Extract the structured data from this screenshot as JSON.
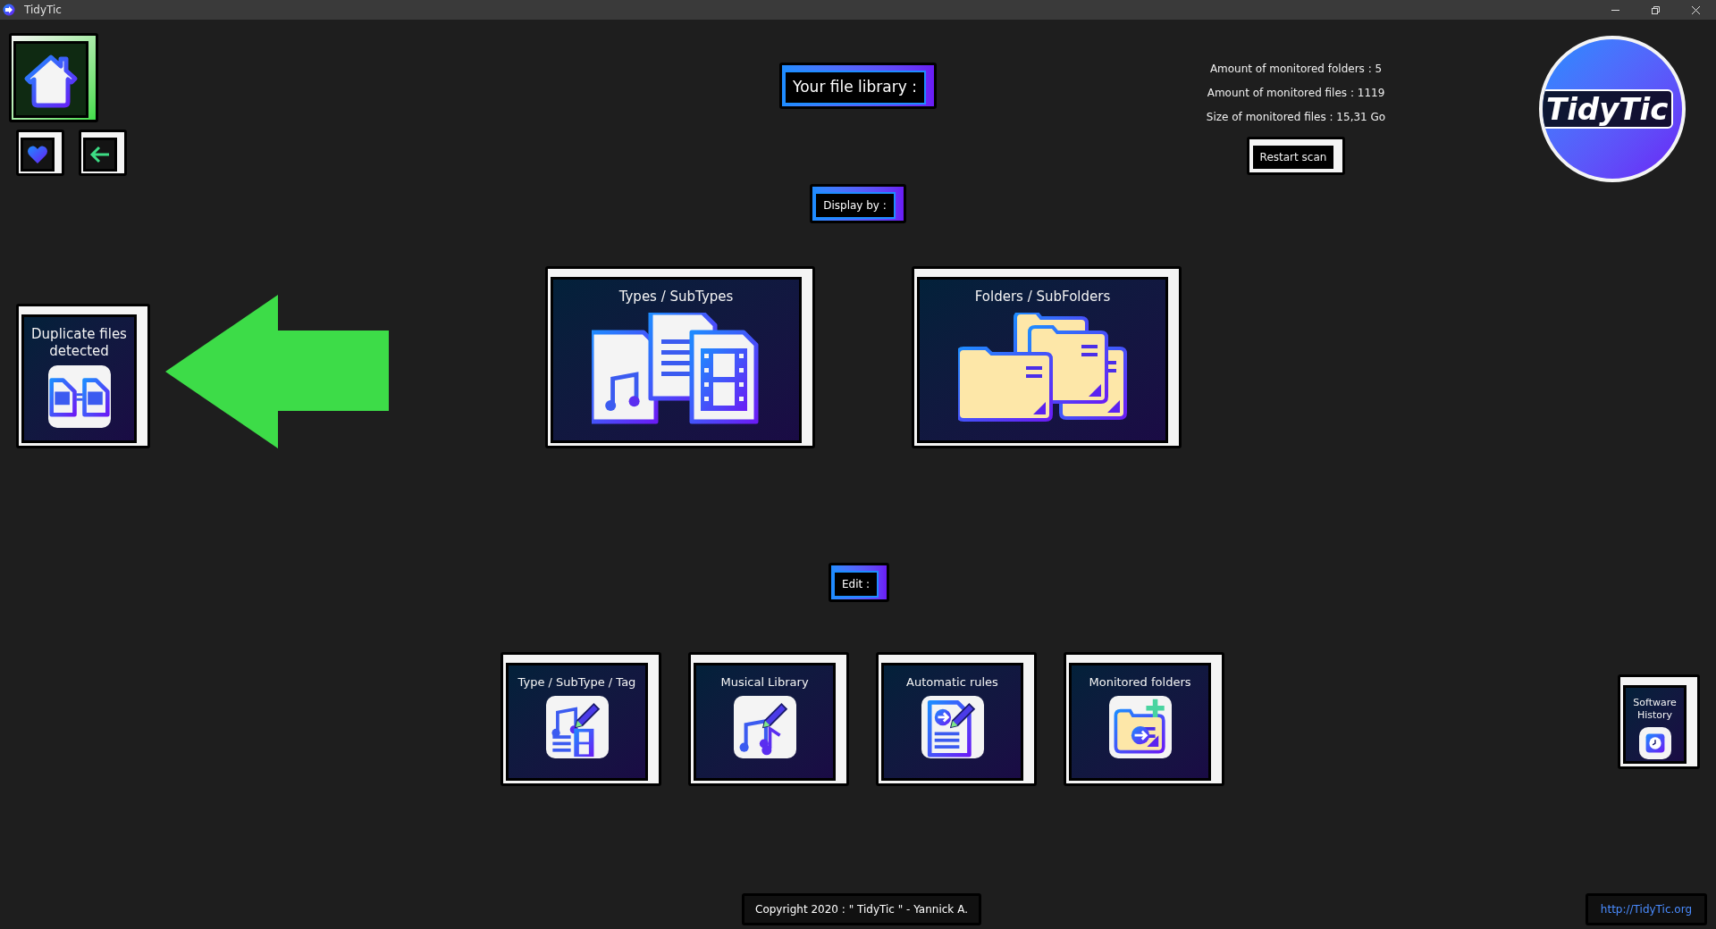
{
  "window": {
    "title": "TidyTic"
  },
  "nav_buttons": [
    {
      "kind": "home",
      "selected": true
    },
    {
      "kind": "favorites",
      "selected": false
    },
    {
      "kind": "back",
      "selected": false
    }
  ],
  "library_title": "Your file library :",
  "stats": [
    "Amount of monitored folders : 5",
    "Amount of monitored files : 1119",
    "Size of monitored files : 15,31 Go"
  ],
  "restart_button": "Restart scan",
  "logo_text": "TidyTic",
  "display_label": "Display by :",
  "display_options": [
    {
      "kind": "types",
      "label": "Types / SubTypes"
    },
    {
      "kind": "folders",
      "label": "Folders / SubFolders"
    }
  ],
  "duplicates": {
    "label": "Duplicate files detected"
  },
  "edit_label": "Edit :",
  "edit_options": [
    {
      "kind": "tags",
      "label": "Type / SubType / Tag"
    },
    {
      "kind": "music",
      "label": "Musical Library"
    },
    {
      "kind": "rules",
      "label": "Automatic rules"
    },
    {
      "kind": "monitored",
      "label": "Monitored folders"
    }
  ],
  "history": {
    "label": "Software History"
  },
  "footer": {
    "copyright": "Copyright 2020 : \" TidyTic \" - Yannick A.",
    "link": "http://TidyTic.org"
  }
}
